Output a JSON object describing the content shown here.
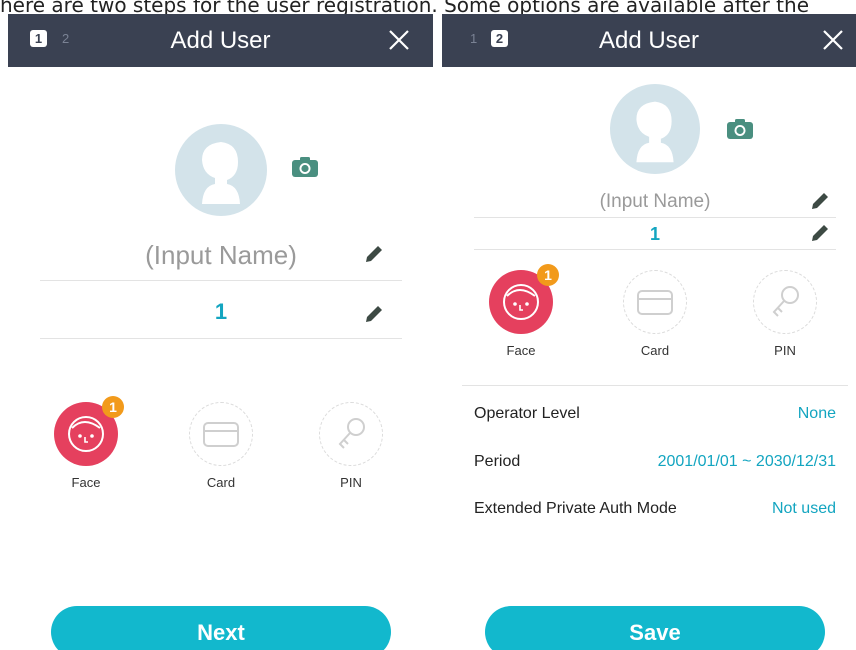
{
  "caption": "here are two steps for the user registration. Some options are available after the",
  "colors": {
    "header": "#3a4152",
    "accent": "#12b8cd",
    "face": "#e5405e",
    "badge": "#f29a1b",
    "value": "#13a5c0"
  },
  "step1": {
    "steps": {
      "active": "1",
      "inactive": "2"
    },
    "title": "Add User",
    "close_icon": "close-icon",
    "avatar_icon": "user-avatar-icon",
    "camera_icon": "camera-icon",
    "name_placeholder": "(Input Name)",
    "user_id": "1",
    "auth_methods": [
      {
        "label": "Face",
        "icon": "face-icon",
        "count": "1"
      },
      {
        "label": "Card",
        "icon": "card-icon"
      },
      {
        "label": "PIN",
        "icon": "key-icon"
      }
    ],
    "button": "Next"
  },
  "step2": {
    "steps": {
      "inactive": "1",
      "active": "2"
    },
    "title": "Add User",
    "close_icon": "close-icon",
    "avatar_icon": "user-avatar-icon",
    "camera_icon": "camera-icon",
    "name_placeholder": "(Input Name)",
    "user_id": "1",
    "auth_methods": [
      {
        "label": "Face",
        "icon": "face-icon",
        "count": "1"
      },
      {
        "label": "Card",
        "icon": "card-icon"
      },
      {
        "label": "PIN",
        "icon": "key-icon"
      }
    ],
    "settings": [
      {
        "label": "Operator Level",
        "value": "None"
      },
      {
        "label": "Period",
        "value": "2001/01/01 ~ 2030/12/31"
      },
      {
        "label": "Extended Private Auth Mode",
        "value": "Not used"
      }
    ],
    "button": "Save"
  }
}
